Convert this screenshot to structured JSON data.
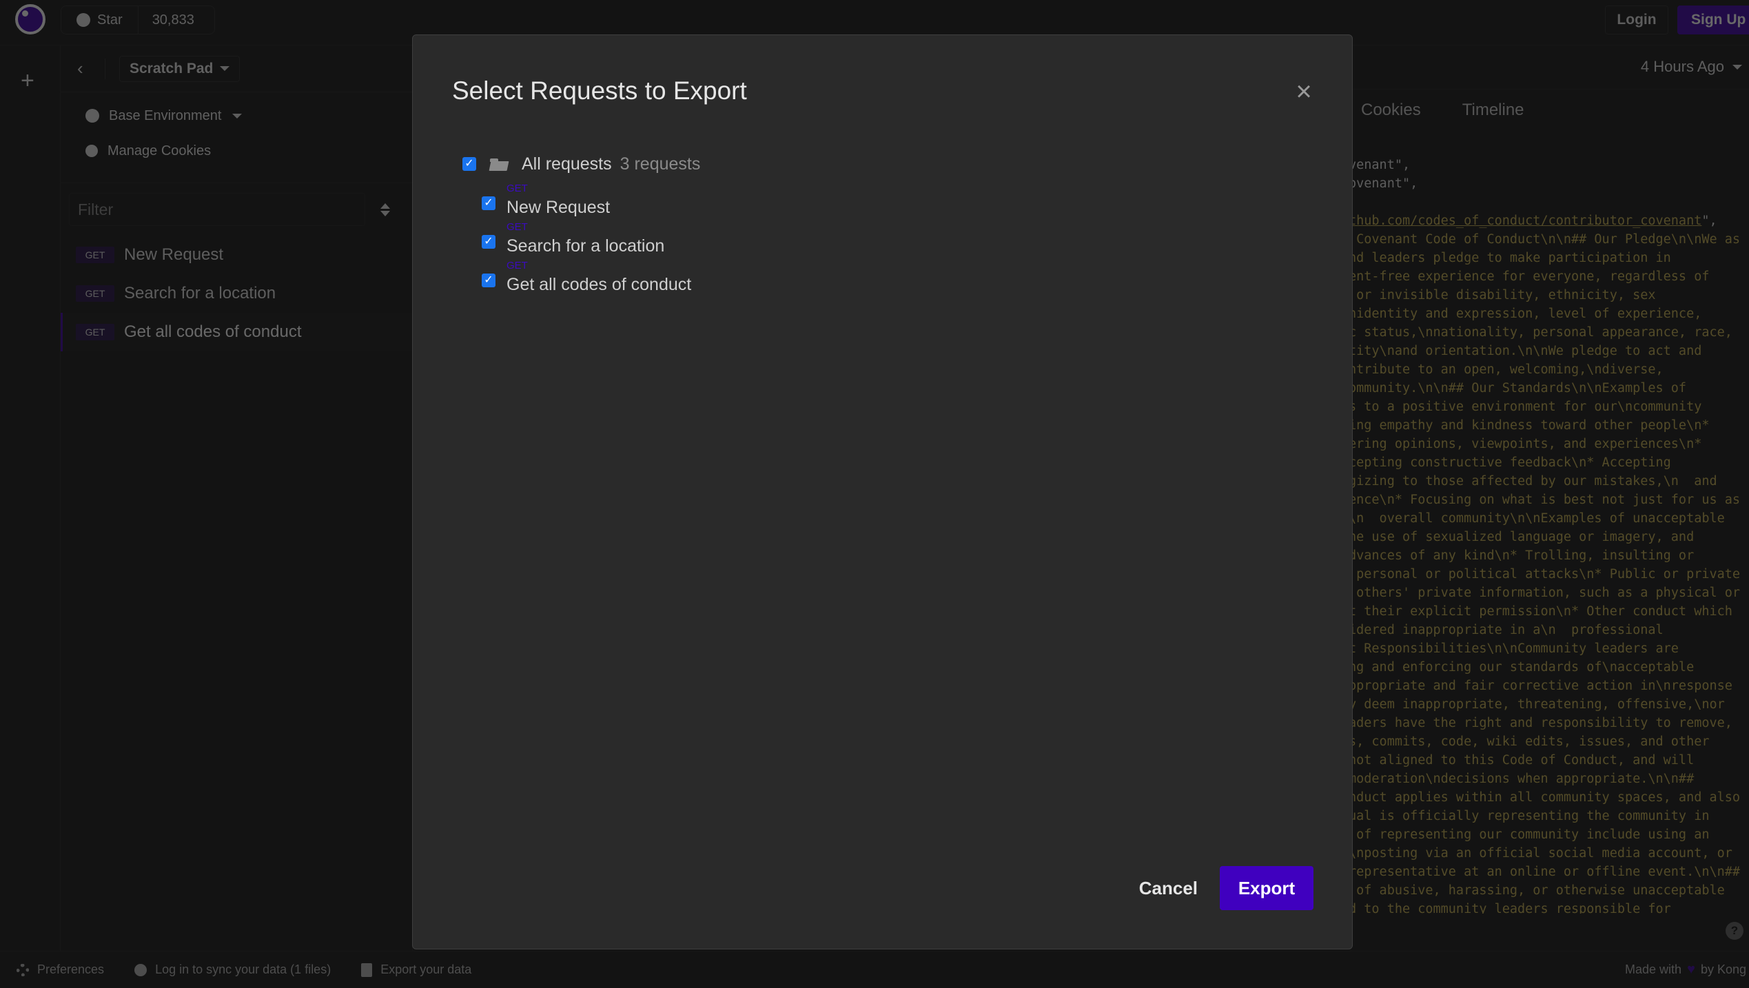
{
  "topbar": {
    "github_star_label": "Star",
    "github_star_count": "30,833",
    "login_label": "Login",
    "signup_label": "Sign Up"
  },
  "sidebar": {
    "workspace_name": "Scratch Pad",
    "environment_label": "Base Environment",
    "cookies_label": "Manage Cookies",
    "filter_placeholder": "Filter",
    "requests": [
      {
        "method": "GET",
        "name": "New Request",
        "active": false
      },
      {
        "method": "GET",
        "name": "Search for a location",
        "active": false
      },
      {
        "method": "GET",
        "name": "Get all codes of conduct",
        "active": true
      }
    ]
  },
  "main": {
    "time_ago": "4 Hours Ago",
    "tabs": [
      "Cookies",
      "Timeline"
    ],
    "response_lines": [
      "venant\",",
      "ovenant\",",
      "",
      "thub.com/codes_of_conduct/contributor_covenant\",",
      " Covenant Code of Conduct\\n\\n## Our Pledge\\n\\nWe as",
      "nd leaders pledge to make participation in",
      "ent-free experience for everyone, regardless of",
      " or invisible disability, ethnicity, sex",
      "nidentity and expression, level of experience,",
      "c status,\\nnationality, personal appearance, race,",
      "tity\\nand orientation.\\n\\nWe pledge to act and",
      "ntribute to an open, welcoming,\\ndiverse,",
      "ommunity.\\n\\n## Our Standards\\n\\nExamples of",
      "s to a positive environment for our\\ncommunity",
      "ing empathy and kindness toward other people\\n*",
      "ering opinions, viewpoints, and experiences\\n*",
      "cepting constructive feedback\\n* Accepting",
      "gizing to those affected by our mistakes,\\n  and",
      "ence\\n* Focusing on what is best not just for us as",
      "\\n  overall community\\n\\nExamples of unacceptable",
      "he use of sexualized language or imagery, and",
      "dvances of any kind\\n* Trolling, insulting or",
      " personal or political attacks\\n* Public or private",
      " others' private information, such as a physical or",
      "t their explicit permission\\n* Other conduct which",
      "idered inappropriate in a\\n  professional",
      "t Responsibilities\\n\\nCommunity leaders are",
      "ng and enforcing our standards of\\nacceptable",
      "ppropriate and fair corrective action in\\nresponse",
      "y deem inappropriate, threatening, offensive,\\nor",
      "aders have the right and responsibility to remove,",
      "s, commits, code, wiki edits, issues, and other",
      "not aligned to this Code of Conduct, and will",
      "moderation\\ndecisions when appropriate.\\n\\n##",
      "nduct applies within all community spaces, and also",
      "ual is officially representing the community in",
      " of representing our community include using an",
      "\\nposting via an official social media account, or",
      "representative at an online or offline event.\\n\\n##",
      " of abusive, harassing, or otherwise unacceptable",
      "d to the community leaders responsible for"
    ],
    "help_label": "?"
  },
  "statusbar": {
    "preferences_label": "Preferences",
    "sync_label": "Log in to sync your data (1 files)",
    "export_label": "Export your data",
    "made_with_prefix": "Made with",
    "made_with_suffix": "by Kong"
  },
  "modal": {
    "title": "Select Requests to Export",
    "root": {
      "label": "All requests",
      "count": "3 requests",
      "checked": true
    },
    "items": [
      {
        "method": "GET",
        "name": "New Request",
        "checked": true
      },
      {
        "method": "GET",
        "name": "Search for a location",
        "checked": true
      },
      {
        "method": "GET",
        "name": "Get all codes of conduct",
        "checked": true
      }
    ],
    "cancel_label": "Cancel",
    "export_label": "Export"
  },
  "colors": {
    "accent": "#4000bf",
    "checkbox": "#1a74ee",
    "method_get": "#3b0bc0"
  }
}
